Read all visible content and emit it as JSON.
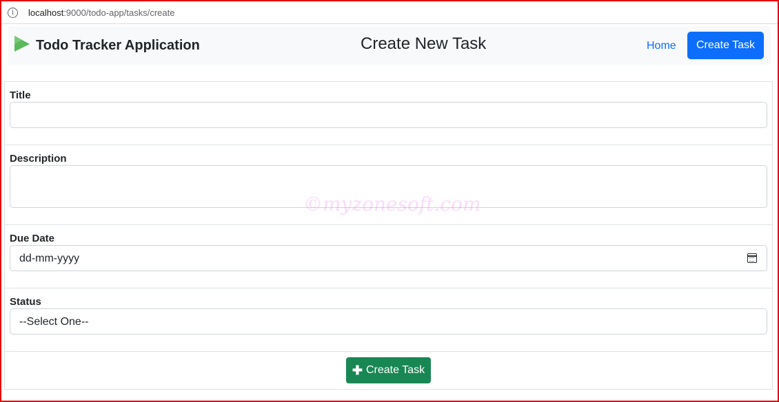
{
  "browser": {
    "url_host": "localhost",
    "url_path": ":9000/todo-app/tasks/create",
    "info_glyph": "i"
  },
  "navbar": {
    "brand": "Todo Tracker Application",
    "page_title": "Create New Task",
    "home_link": "Home",
    "create_task_button": "Create Task",
    "logo_icon": "play-triangle-icon",
    "colors": {
      "primary": "#0d6efd",
      "navbar_bg": "#f8f9fa",
      "logo": "#5cb85c"
    }
  },
  "form": {
    "title_label": "Title",
    "title_value": "",
    "description_label": "Description",
    "description_value": "",
    "due_date_label": "Due Date",
    "due_date_placeholder": "dd-mm-yyyy",
    "status_label": "Status",
    "status_selected": "--Select One--",
    "submit_button": "Create Task",
    "submit_icon": "plus-icon",
    "submit_color": "#198754"
  },
  "watermark": "©myzonesoft.com"
}
